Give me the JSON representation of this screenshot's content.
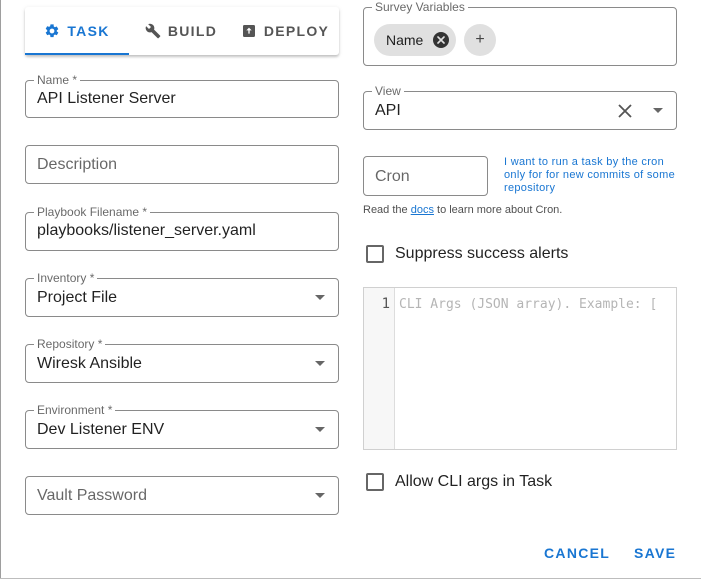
{
  "tabs": [
    {
      "label": "TASK",
      "icon": "gear-icon",
      "active": true
    },
    {
      "label": "BUILD",
      "icon": "wrench-icon",
      "active": false
    },
    {
      "label": "DEPLOY",
      "icon": "upload-box-icon",
      "active": false
    }
  ],
  "form": {
    "name": {
      "label": "Name *",
      "value": "API Listener Server"
    },
    "description": {
      "placeholder": "Description"
    },
    "playbook": {
      "label": "Playbook Filename *",
      "value": "playbooks/listener_server.yaml"
    },
    "inventory": {
      "label": "Inventory *",
      "value": "Project File"
    },
    "repository": {
      "label": "Repository *",
      "value": "Wiresk Ansible"
    },
    "environment": {
      "label": "Environment *",
      "value": "Dev Listener ENV"
    },
    "vault": {
      "placeholder": "Vault Password"
    }
  },
  "survey": {
    "label": "Survey Variables",
    "chips": [
      {
        "label": "Name"
      }
    ],
    "add_label": "+"
  },
  "view": {
    "label": "View",
    "value": "API"
  },
  "cron": {
    "placeholder": "Cron",
    "hint": "I want to run a task by the cron only for for new commits of some repository",
    "note_prefix": "Read the ",
    "note_link": "docs",
    "note_suffix": " to learn more about Cron."
  },
  "suppress": {
    "label": "Suppress success alerts",
    "checked": false
  },
  "cli_editor": {
    "line_number": "1",
    "placeholder": "CLI Args (JSON array). Example: ["
  },
  "allow_cli": {
    "label": "Allow CLI args in Task",
    "checked": false
  },
  "actions": {
    "cancel": "CANCEL",
    "save": "SAVE"
  },
  "colors": {
    "accent": "#1976d2",
    "chip": "#e0e0e0",
    "border": "#8a8a8a"
  }
}
